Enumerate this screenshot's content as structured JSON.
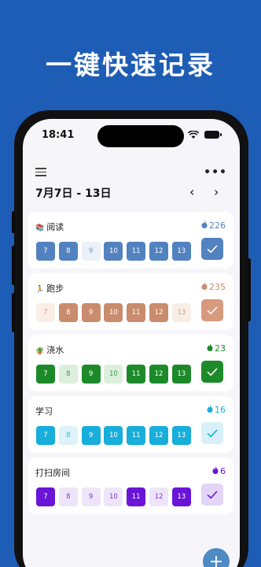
{
  "hero": {
    "title": "一键快速记录"
  },
  "status_bar": {
    "time": "18:41"
  },
  "header": {
    "week_range": "7月7日 - 13日",
    "prev": "‹",
    "next": "›",
    "more": "•••"
  },
  "fab": {
    "label": "+"
  },
  "habits": [
    {
      "emoji": "📚",
      "name": "阅读",
      "count": "226",
      "color": "#5282c0",
      "light": "#e9eef6",
      "check_bg": "#5282c0",
      "check_fg": "#ffffff",
      "days": [
        {
          "n": "7",
          "done": true
        },
        {
          "n": "8",
          "done": true
        },
        {
          "n": "9",
          "done": false
        },
        {
          "n": "10",
          "done": true
        },
        {
          "n": "11",
          "done": true
        },
        {
          "n": "12",
          "done": true
        },
        {
          "n": "13",
          "done": true
        }
      ]
    },
    {
      "emoji": "🏃",
      "name": "跑步",
      "count": "235",
      "color": "#c98c6d",
      "light": "#f8ebe4",
      "check_bg": "#d79a7d",
      "check_fg": "#ffffff",
      "days": [
        {
          "n": "7",
          "done": false
        },
        {
          "n": "8",
          "done": true
        },
        {
          "n": "9",
          "done": true
        },
        {
          "n": "10",
          "done": true
        },
        {
          "n": "11",
          "done": true
        },
        {
          "n": "12",
          "done": true
        },
        {
          "n": "13",
          "done": false
        }
      ]
    },
    {
      "emoji": "🪴",
      "name": "浇水",
      "count": "23",
      "color": "#1d8a2a",
      "light": "#d6edd7",
      "check_bg": "#1d8a2a",
      "check_fg": "#ffffff",
      "days": [
        {
          "n": "7",
          "done": true
        },
        {
          "n": "8",
          "done": false
        },
        {
          "n": "9",
          "done": true
        },
        {
          "n": "10",
          "done": false
        },
        {
          "n": "11",
          "done": true
        },
        {
          "n": "12",
          "done": true
        },
        {
          "n": "13",
          "done": true
        }
      ]
    },
    {
      "emoji": "",
      "name": "学习",
      "count": "16",
      "color": "#17aedb",
      "light": "#d8f1f8",
      "check_bg": "#d8f1f8",
      "check_fg": "#17aedb",
      "days": [
        {
          "n": "7",
          "done": true
        },
        {
          "n": "8",
          "done": false
        },
        {
          "n": "9",
          "done": true
        },
        {
          "n": "10",
          "done": true
        },
        {
          "n": "11",
          "done": true
        },
        {
          "n": "12",
          "done": true
        },
        {
          "n": "13",
          "done": true
        }
      ]
    },
    {
      "emoji": "",
      "name": "打扫房间",
      "count": "6",
      "color": "#6a14d8",
      "light": "#ece1fa",
      "check_bg": "#e2d5f8",
      "check_fg": "#6a14d8",
      "days": [
        {
          "n": "7",
          "done": true
        },
        {
          "n": "8",
          "done": false
        },
        {
          "n": "9",
          "done": false
        },
        {
          "n": "10",
          "done": false
        },
        {
          "n": "11",
          "done": true
        },
        {
          "n": "12",
          "done": false
        },
        {
          "n": "13",
          "done": true
        }
      ]
    }
  ]
}
